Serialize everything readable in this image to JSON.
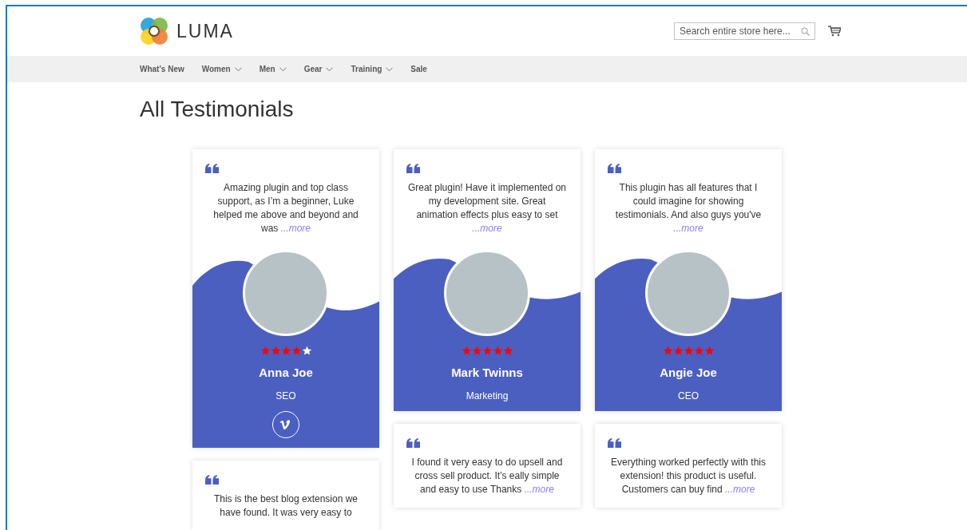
{
  "header": {
    "brand": "LUMA",
    "search": {
      "placeholder": "Search entire store here..."
    }
  },
  "nav": [
    {
      "label": "What's New",
      "dropdown": false
    },
    {
      "label": "Women",
      "dropdown": true
    },
    {
      "label": "Men",
      "dropdown": true
    },
    {
      "label": "Gear",
      "dropdown": true
    },
    {
      "label": "Training",
      "dropdown": true
    },
    {
      "label": "Sale",
      "dropdown": false
    }
  ],
  "page_title": "All Testimonials",
  "columns": [
    [
      {
        "quote": "Amazing plugin and top class support, as I’m a beginner, Luke helped me above and beyond and was",
        "more": "...more",
        "profile": {
          "stars": 4,
          "name": "Anna Joe",
          "role": "SEO",
          "social": [
            {
              "kind": "vimeo"
            }
          ]
        }
      },
      {
        "quote": "This is the best blog extension we have found. It was very easy to"
      }
    ],
    [
      {
        "quote": "Great plugin! Have it implemented on my development site. Great animation effects plus easy to set",
        "more": "...more",
        "profile": {
          "stars": 5,
          "name": "Mark Twinns",
          "role": "Marketing"
        }
      },
      {
        "quote": "I found it very easy to do upsell and cross sell product. It's eally simple and easy to use Thanks",
        "more": "...more"
      }
    ],
    [
      {
        "quote": "This plugin has all features that I could imagine for showing testimonials. And also guys you've",
        "more": "...more",
        "profile": {
          "stars": 5,
          "name": "Angie Joe",
          "role": "CEO"
        }
      },
      {
        "quote": "Everything worked perfectly with this extension! this product is useful. Customers can buy find",
        "more": "...more"
      }
    ]
  ]
}
